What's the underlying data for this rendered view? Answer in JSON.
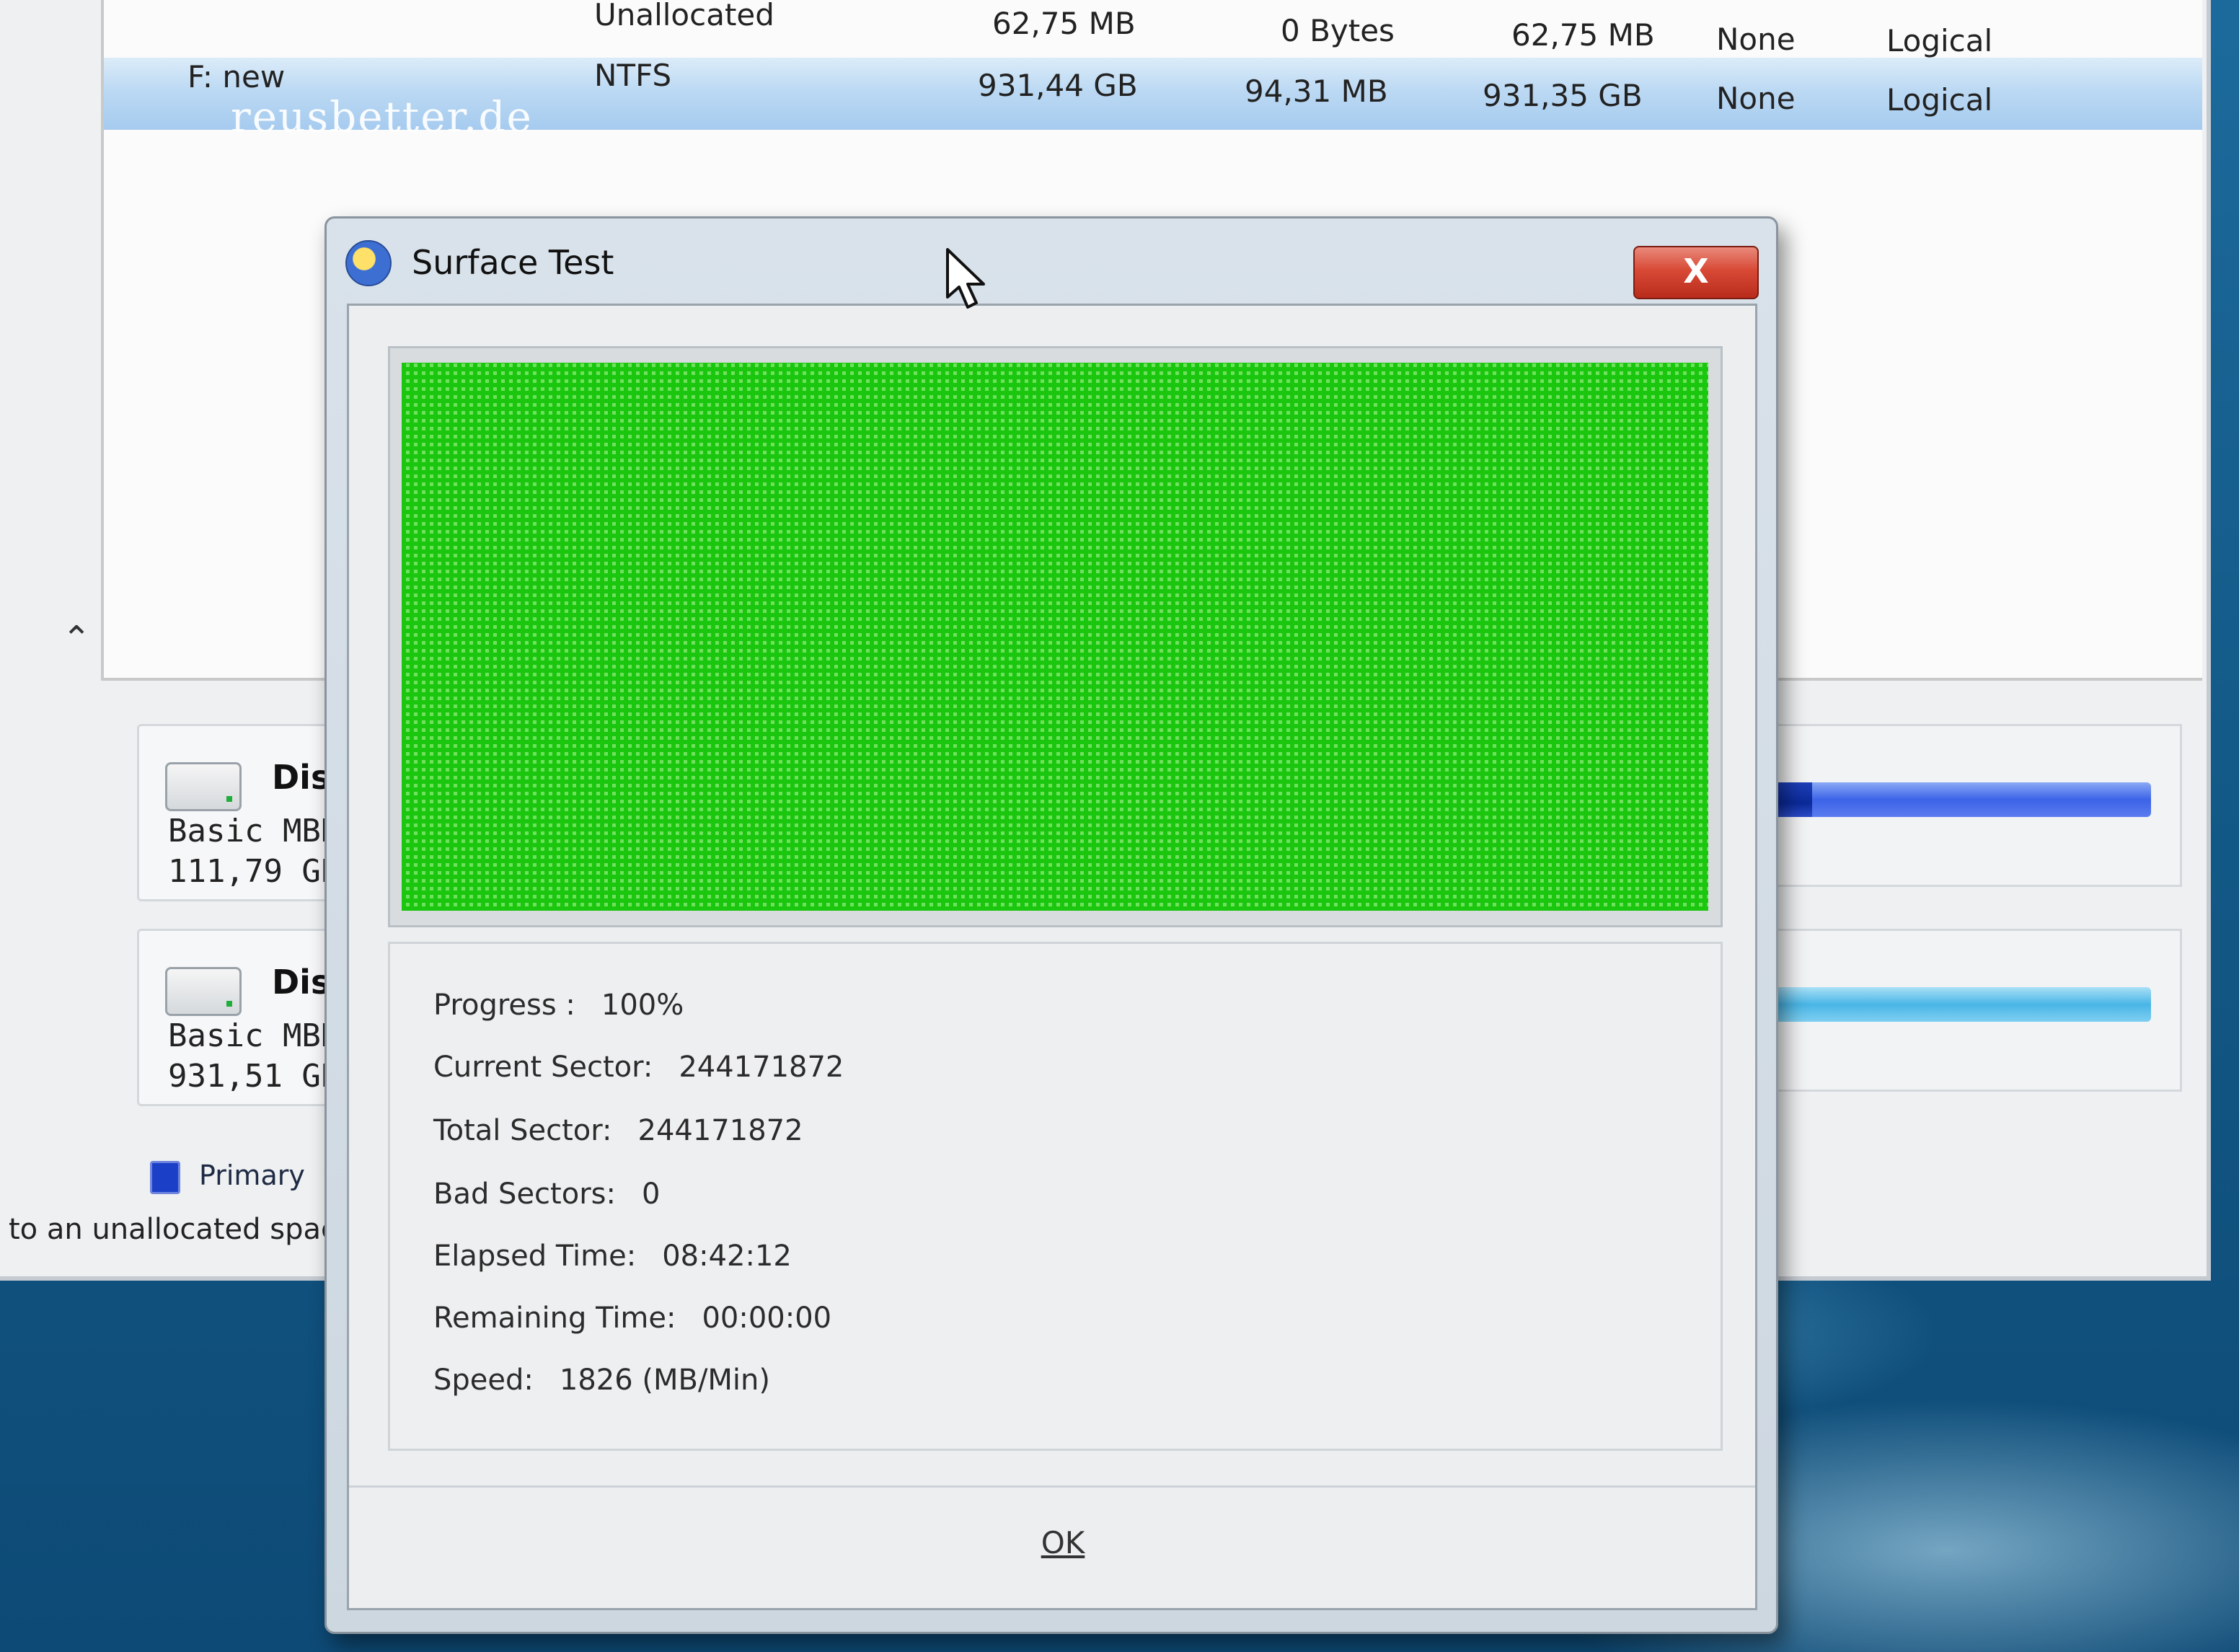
{
  "partitions": [
    {
      "name": "",
      "filesystem": "Unallocated",
      "capacity": "62,75 MB",
      "used": "0 Bytes",
      "unused": "62,75 MB",
      "flag": "None",
      "type": "Logical"
    },
    {
      "name": "F: new",
      "filesystem": "NTFS",
      "capacity": "931,44 GB",
      "used": "94,31 MB",
      "unused": "931,35 GB",
      "flag": "None",
      "type": "Logical"
    }
  ],
  "watermark": "reusbetter.de",
  "disks": [
    {
      "name": "Disk",
      "type": "Basic MBR",
      "size": "111,79 GB",
      "usage_fraction": 0.13
    },
    {
      "name": "Disk",
      "type": "Basic MBR",
      "size": "931,51 GB",
      "usage_fraction": 0.0
    }
  ],
  "legend": {
    "primary_label": "Primary"
  },
  "status_text": "to an unallocated space.",
  "dialog": {
    "title": "Surface Test",
    "close_label": "X",
    "ok_label": "OK",
    "stats": [
      {
        "label": "Progress :",
        "value": "100%"
      },
      {
        "label": "Current Sector:",
        "value": "244171872"
      },
      {
        "label": "Total Sector:",
        "value": "244171872"
      },
      {
        "label": "Bad Sectors:",
        "value": "0"
      },
      {
        "label": "Elapsed Time:",
        "value": "08:42:12"
      },
      {
        "label": "Remaining Time:",
        "value": "00:00:00"
      },
      {
        "label": "Speed:",
        "value": "1826 (MB/Min)"
      }
    ]
  },
  "colors": {
    "sector_ok": "#1bc60f",
    "selected_row": "#a6cbef",
    "close_button": "#d84a36"
  },
  "icons": {
    "app": "disk-wizard-icon",
    "collapse": "double-chevron-up-icon",
    "cursor": "mouse-pointer-icon"
  }
}
